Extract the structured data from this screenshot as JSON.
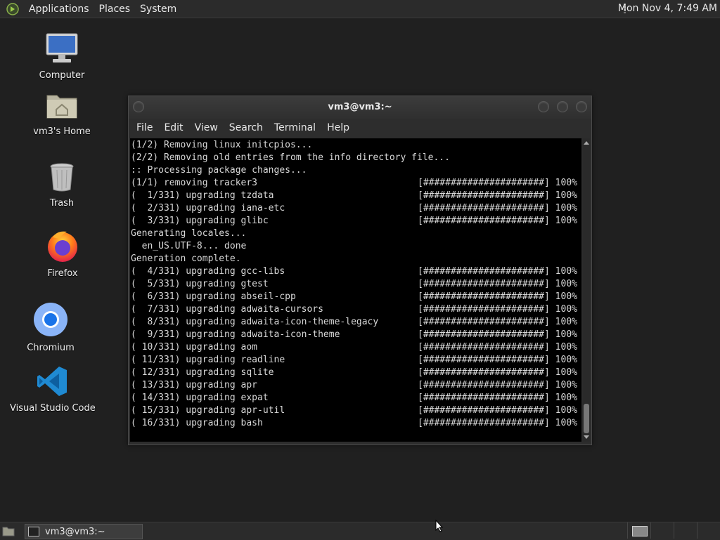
{
  "top_panel": {
    "menus": [
      "Applications",
      "Places",
      "System"
    ],
    "clock": "Mon Nov  4,  7:49 AM"
  },
  "desktop_icons": [
    {
      "label": "Computer",
      "icon": "computer-icon"
    },
    {
      "label": "vm3's Home",
      "icon": "home-folder-icon"
    },
    {
      "label": "Trash",
      "icon": "trash-icon"
    },
    {
      "label": "Firefox",
      "icon": "firefox-icon"
    },
    {
      "label": "Chromium",
      "icon": "chromium-icon"
    },
    {
      "label": "Visual Studio Code",
      "icon": "vscode-icon"
    }
  ],
  "terminal": {
    "title": "vm3@vm3:~",
    "menu": [
      "File",
      "Edit",
      "View",
      "Search",
      "Terminal",
      "Help"
    ],
    "lines": [
      {
        "text": "(1/2) Removing linux initcpios...",
        "progress": ""
      },
      {
        "text": "(2/2) Removing old entries from the info directory file...",
        "progress": ""
      },
      {
        "text": ":: Processing package changes...",
        "progress": ""
      },
      {
        "text": "(1/1) removing tracker3",
        "progress": "[######################] 100%"
      },
      {
        "text": "(  1/331) upgrading tzdata",
        "progress": "[######################] 100%"
      },
      {
        "text": "(  2/331) upgrading iana-etc",
        "progress": "[######################] 100%"
      },
      {
        "text": "(  3/331) upgrading glibc",
        "progress": "[######################] 100%"
      },
      {
        "text": "Generating locales...",
        "progress": ""
      },
      {
        "text": "  en_US.UTF-8... done",
        "progress": ""
      },
      {
        "text": "Generation complete.",
        "progress": ""
      },
      {
        "text": "(  4/331) upgrading gcc-libs",
        "progress": "[######################] 100%"
      },
      {
        "text": "(  5/331) upgrading gtest",
        "progress": "[######################] 100%"
      },
      {
        "text": "(  6/331) upgrading abseil-cpp",
        "progress": "[######################] 100%"
      },
      {
        "text": "(  7/331) upgrading adwaita-cursors",
        "progress": "[######################] 100%"
      },
      {
        "text": "(  8/331) upgrading adwaita-icon-theme-legacy",
        "progress": "[######################] 100%"
      },
      {
        "text": "(  9/331) upgrading adwaita-icon-theme",
        "progress": "[######################] 100%"
      },
      {
        "text": "( 10/331) upgrading aom",
        "progress": "[######################] 100%"
      },
      {
        "text": "( 11/331) upgrading readline",
        "progress": "[######################] 100%"
      },
      {
        "text": "( 12/331) upgrading sqlite",
        "progress": "[######################] 100%"
      },
      {
        "text": "( 13/331) upgrading apr",
        "progress": "[######################] 100%"
      },
      {
        "text": "( 14/331) upgrading expat",
        "progress": "[######################] 100%"
      },
      {
        "text": "( 15/331) upgrading apr-util",
        "progress": "[######################] 100%"
      },
      {
        "text": "( 16/331) upgrading bash",
        "progress": "[######################] 100%"
      }
    ]
  },
  "taskbar": {
    "window_button": "vm3@vm3:~"
  },
  "colors": {
    "desktop_bg": "#202020",
    "panel_bg": "#2b2b2b",
    "terminal_bg": "#000000",
    "terminal_fg": "#d8d8d8"
  }
}
